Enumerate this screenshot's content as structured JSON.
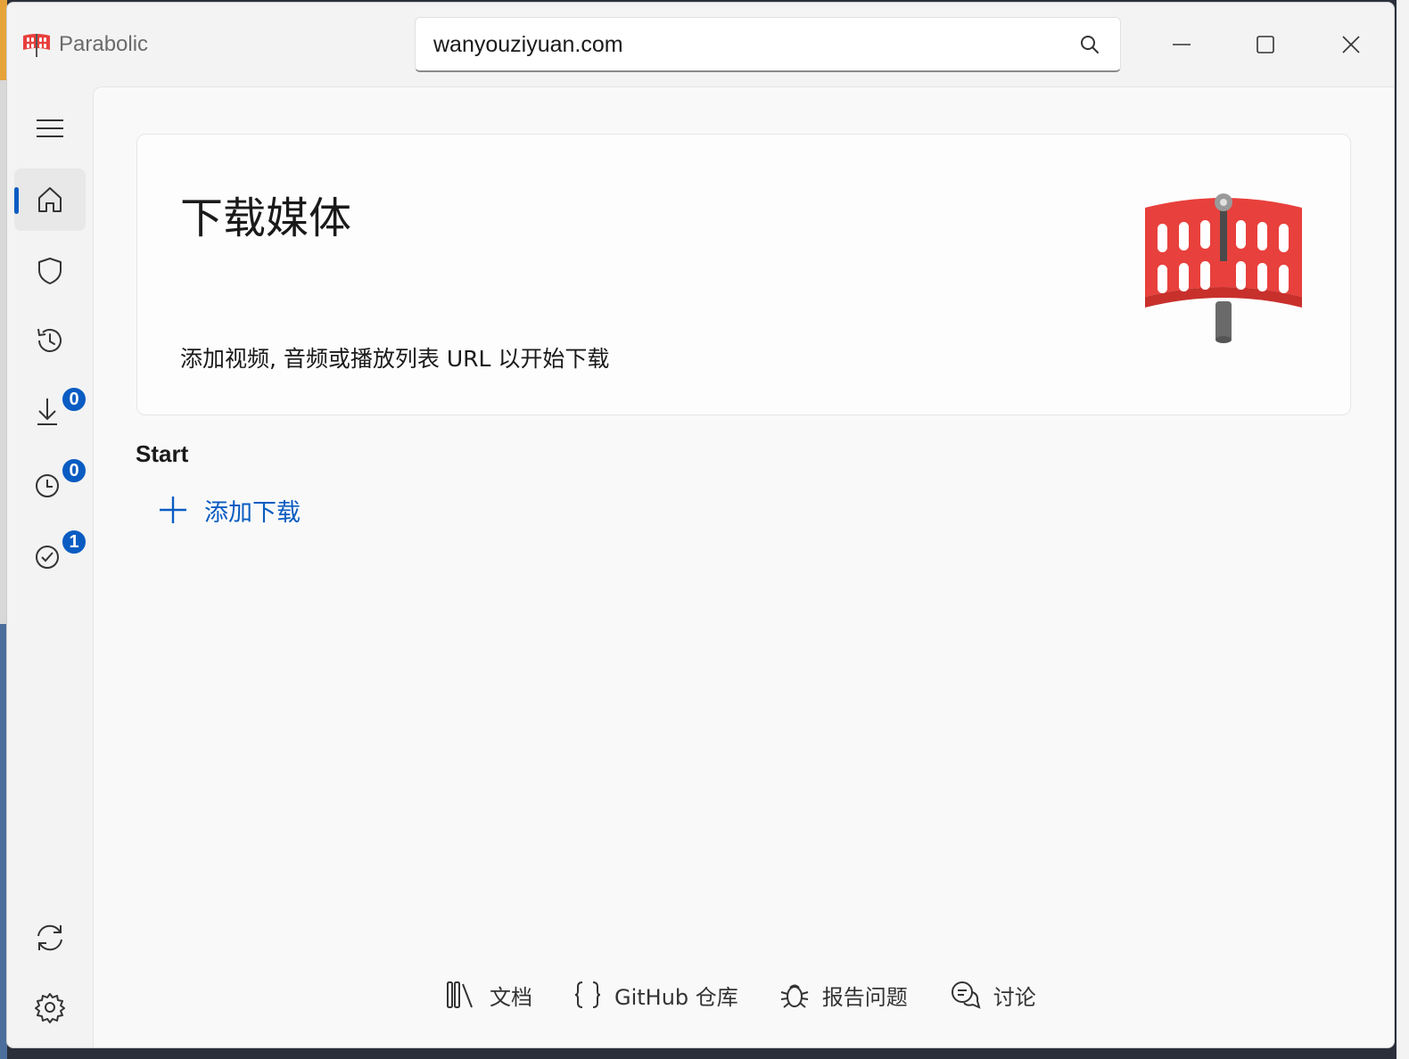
{
  "app": {
    "title": "Parabolic"
  },
  "search": {
    "value": "wanyouziyuan.com"
  },
  "sidebar": {
    "items": [
      {
        "name": "menu",
        "badge": null
      },
      {
        "name": "home",
        "badge": null,
        "active": true
      },
      {
        "name": "keyring",
        "badge": null
      },
      {
        "name": "history",
        "badge": null
      },
      {
        "name": "downloading",
        "badge": "0"
      },
      {
        "name": "queued",
        "badge": "0"
      },
      {
        "name": "completed",
        "badge": "1"
      },
      {
        "name": "update",
        "badge": null
      },
      {
        "name": "settings",
        "badge": null
      }
    ]
  },
  "main": {
    "title": "下载媒体",
    "subtitle": "添加视频, 音频或播放列表 URL 以开始下载",
    "section_label": "Start",
    "add_download_label": "添加下载"
  },
  "footer": {
    "docs_label": "文档",
    "github_label": "GitHub 仓库",
    "report_label": "报告问题",
    "discuss_label": "讨论"
  },
  "colors": {
    "accent": "#0a5cc2",
    "logo_red": "#e8403c",
    "background": "#f3f3f3",
    "content_bg": "#f9f9f9"
  }
}
